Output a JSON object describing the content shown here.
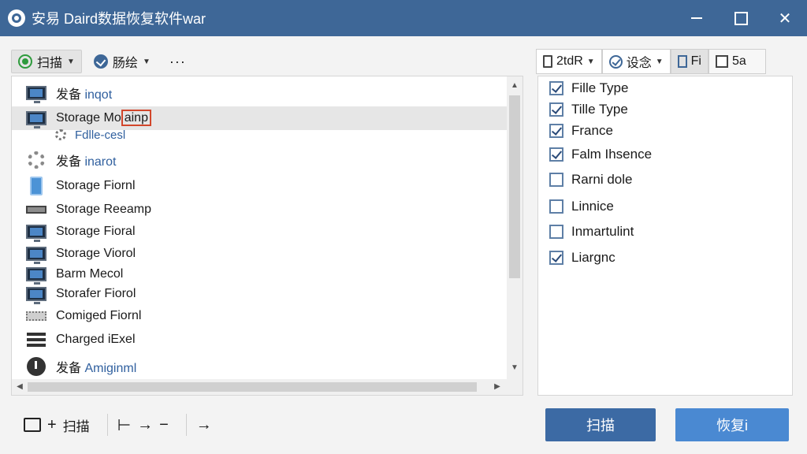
{
  "window": {
    "title": "安易 Daird数据恢复软件war",
    "controls": {
      "close": "✕"
    }
  },
  "left_toolbar": {
    "scan_label": "扫描",
    "secondary_label": "肠绘",
    "more_label": "···"
  },
  "tree": {
    "rows": [
      {
        "prefix": "发备 ",
        "name": "inqot",
        "icon": "monitor-icon"
      },
      {
        "prefix": "",
        "name": "Storage Mo",
        "highlight": "ainp",
        "icon": "monitor-icon",
        "selected": true
      },
      {
        "prefix": "",
        "name": "Fdlle-cesl",
        "icon": "gear-icon",
        "sub": true
      },
      {
        "prefix": "发备 ",
        "name": "inarot",
        "icon": "gear-icon"
      },
      {
        "prefix": "",
        "name": "Storage Fiornl",
        "icon": "phone-icon"
      },
      {
        "prefix": "",
        "name": "Storage Reeamp",
        "icon": "drive-bar-icon"
      },
      {
        "prefix": "",
        "name": "Storage Fioral",
        "icon": "monitor-icon"
      },
      {
        "prefix": "",
        "name": "Storage Viorol",
        "icon": "monitor-icon"
      },
      {
        "prefix": "",
        "name": "Barm Mecol",
        "icon": "monitor-icon"
      },
      {
        "prefix": "",
        "name": "Storafer Fiorol",
        "icon": "monitor-icon"
      },
      {
        "prefix": "",
        "name": "Comiged Fiornl",
        "icon": "dots-drive-icon"
      },
      {
        "prefix": "",
        "name": "Charged iExel",
        "icon": "stack-icon"
      },
      {
        "prefix": "发备 ",
        "name": "Amiginml",
        "icon": "disc-icon"
      }
    ]
  },
  "right_toolbar": {
    "tab1": "2tdR",
    "tab2": "设念",
    "tab3": "Fi",
    "tab4": "5a"
  },
  "options": [
    {
      "label": "Fille Type",
      "checked": true
    },
    {
      "label": "Tille Type",
      "checked": true
    },
    {
      "label": "France",
      "checked": true
    },
    {
      "label": "Falm Ihsence",
      "checked": true
    },
    {
      "label": "Rarni dole",
      "checked": false
    },
    {
      "label": "Linnice",
      "checked": false
    },
    {
      "label": "Inmartulint",
      "checked": false
    },
    {
      "label": "Liargnc",
      "checked": true
    }
  ],
  "bottom": {
    "scan_label": "扫描",
    "plus": "+",
    "nav1": "⊢",
    "nav2": "→",
    "nav3": "−",
    "nav4": "→",
    "scan_button": "扫描",
    "recover_button": "恢复i"
  },
  "colors": {
    "titlebar": "#3e6797",
    "scan_button": "#3c6aa4",
    "recover_button": "#4a89d2",
    "highlight_box": "#d2462b"
  }
}
